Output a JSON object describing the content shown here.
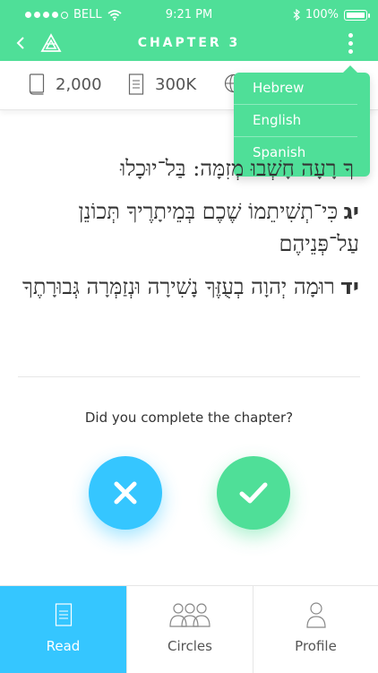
{
  "status": {
    "carrier": "BELL",
    "time": "9:21 PM",
    "battery": "100%"
  },
  "nav": {
    "title": "CHAPTER 3"
  },
  "info": {
    "words": "2,000",
    "reads": "300K"
  },
  "language_menu": {
    "items": [
      "Hebrew",
      "English",
      "Spanish"
    ]
  },
  "verses": [
    {
      "num": "",
      "text": "ךָ רָעָה חָשְׁבוּ מְזִמָּה: בַּל־יוּכָלוּ"
    },
    {
      "num": "יג",
      "text": "כִּי־תְשִׁיתֵמוֹ שֶׁכֶם בְּמֵיתָרֶיךָ תְּכוֹנֵן עַל־פְּנֵיהֶם"
    },
    {
      "num": "יד",
      "text": "רוּמָה יְהוָה בְעֻזֶּךָ נָשִׁירָה וּנְזַמְּרָה גְּבוּרָתֶךָ"
    }
  ],
  "prompt": {
    "question": "Did you complete the chapter?"
  },
  "tabs": {
    "read": "Read",
    "circles": "Circles",
    "profile": "Profile"
  },
  "colors": {
    "green": "#4fdf98",
    "blue": "#35c6ff"
  }
}
